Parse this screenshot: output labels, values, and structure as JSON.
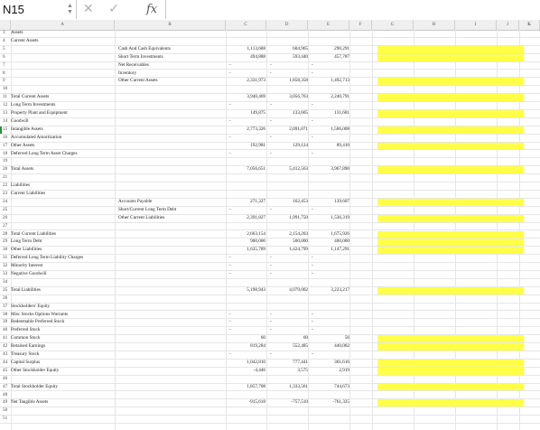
{
  "name_box": "N15",
  "formula_bar": {
    "cancel_glyph": "✕",
    "enter_glyph": "✓",
    "fx_label": "fx",
    "content": ""
  },
  "columns": [
    "A",
    "B",
    "C",
    "D",
    "E",
    "F",
    "G",
    "H",
    "I",
    "J",
    "K",
    "L"
  ],
  "rows": [
    {
      "n": "3",
      "a": "Assets"
    },
    {
      "n": "4",
      "a": "Current Assets"
    },
    {
      "n": "5",
      "b": "Cash And Cash Equivalents",
      "c": "1,113,608",
      "d": "604,965",
      "e": "290,291"
    },
    {
      "n": "6",
      "b": "Short Term Investments",
      "c": "494,888",
      "d": "593,440",
      "e": "457,787"
    },
    {
      "n": "7",
      "b": "Net Receivables",
      "c": "-",
      "d": "-",
      "e": "-"
    },
    {
      "n": "8",
      "b": "Inventory",
      "c": "-",
      "d": "-",
      "e": "-"
    },
    {
      "n": "9",
      "b": "Other Current Assets",
      "c": "2,331,973",
      "d": "1,858,358",
      "e": "1,492,713"
    },
    {
      "n": "10"
    },
    {
      "n": "11",
      "a": "Total Current Assets",
      "c": "3,940,469",
      "d": "3,056,763",
      "e": "2,240,791"
    },
    {
      "n": "12",
      "a": "Long Term Investments",
      "c": "-",
      "d": "-",
      "e": "-"
    },
    {
      "n": "13",
      "a": "Property Plant and Equipment",
      "c": "149,875",
      "d": "133,605",
      "e": "131,681"
    },
    {
      "n": "14",
      "a": "Goodwill",
      "c": "-",
      "d": "-",
      "e": "-"
    },
    {
      "n": "15",
      "a": "Intangible Assets",
      "c": "2,773,326",
      "d": "2,091,071",
      "e": "1,506,008"
    },
    {
      "n": "16",
      "a": "Accumulated Amortization",
      "c": "-",
      "d": "-",
      "e": "-"
    },
    {
      "n": "17",
      "a": "Other Assets",
      "c": "192,981",
      "d": "129,124",
      "e": "89,410"
    },
    {
      "n": "18",
      "a": "Deferred Long Term Asset Charges",
      "c": "-",
      "d": "-",
      "e": "-"
    },
    {
      "n": "19"
    },
    {
      "n": "20",
      "a": "Total Assets",
      "c": "7,056,651",
      "d": "5,412,563",
      "e": "3,967,890"
    },
    {
      "n": "21"
    },
    {
      "n": "22",
      "a": "Liabilities"
    },
    {
      "n": "23",
      "a": "Current Liabilities"
    },
    {
      "n": "24",
      "b": "Accounts Payable",
      "c": "271,327",
      "d": "162,453",
      "e": "139,607"
    },
    {
      "n": "25",
      "b": "Short/Current Long Term Debt",
      "c": "-",
      "d": "-",
      "e": "-"
    },
    {
      "n": "26",
      "b": "Other Current Liabilities",
      "c": "2,391,827",
      "d": "1,991,750",
      "e": "1,536,319"
    },
    {
      "n": "27"
    },
    {
      "n": "28",
      "a": "Total Current Liabilities",
      "c": "2,663,154",
      "d": "2,154,203",
      "e": "1,675,926"
    },
    {
      "n": "29",
      "a": "Long Term Debt",
      "c": "900,000",
      "d": "500,000",
      "e": "400,000"
    },
    {
      "n": "30",
      "a": "Other Liabilities",
      "c": "1,635,789",
      "d": "1,424,799",
      "e": "1,147,291"
    },
    {
      "n": "31",
      "a": "Deferred Long Term Liability Charges",
      "c": "-",
      "d": "-",
      "e": "-"
    },
    {
      "n": "32",
      "a": "Minority Interest",
      "c": "-",
      "d": "-",
      "e": "-"
    },
    {
      "n": "33",
      "a": "Negative Goodwill",
      "c": "-",
      "d": "-",
      "e": "-"
    },
    {
      "n": "34"
    },
    {
      "n": "35",
      "a": "Total Liabilities",
      "c": "5,198,943",
      "d": "4,079,002",
      "e": "3,223,217"
    },
    {
      "n": "36"
    },
    {
      "n": "37",
      "a": "Stockholders' Equity"
    },
    {
      "n": "38",
      "a": "Misc Stocks Options Warrants",
      "c": "-",
      "d": "-",
      "e": "-"
    },
    {
      "n": "39",
      "a": "Redeemable Preferred Stock",
      "c": "-",
      "d": "-",
      "e": "-"
    },
    {
      "n": "40",
      "a": "Preferred Stock",
      "c": "-",
      "d": "-",
      "e": "-"
    },
    {
      "n": "41",
      "a": "Common Stock",
      "c": "60",
      "d": "60",
      "e": "56"
    },
    {
      "n": "42",
      "a": "Retained Earnings",
      "c": "819,284",
      "d": "552,485",
      "e": "440,082"
    },
    {
      "n": "43",
      "a": "Treasury Stock",
      "c": "-",
      "d": "-",
      "e": "-"
    },
    {
      "n": "44",
      "a": "Capital Surplus",
      "c": "1,042,810",
      "d": "777,441",
      "e": "301,616"
    },
    {
      "n": "45",
      "a": "Other Stockholder Equity",
      "c": "-4,446",
      "d": "3,575",
      "e": "2,919"
    },
    {
      "n": "46"
    },
    {
      "n": "47",
      "a": "Total Stockholder Equity",
      "c": "1,857,708",
      "d": "1,333,561",
      "e": "744,673"
    },
    {
      "n": "48"
    },
    {
      "n": "49",
      "a": "Net Tangible Assets",
      "c": "-915,618",
      "d": "-757,510",
      "e": "-761,335"
    },
    {
      "n": "50"
    },
    {
      "n": "51"
    }
  ],
  "highlight_color": "#ffff47",
  "highlighted_row_numbers": [
    "5",
    "6",
    "9",
    "11",
    "13",
    "15",
    "17",
    "20",
    "24",
    "26",
    "28",
    "29",
    "30",
    "35",
    "41",
    "42",
    "44",
    "45",
    "47",
    "49"
  ],
  "selected_cell": "N15"
}
